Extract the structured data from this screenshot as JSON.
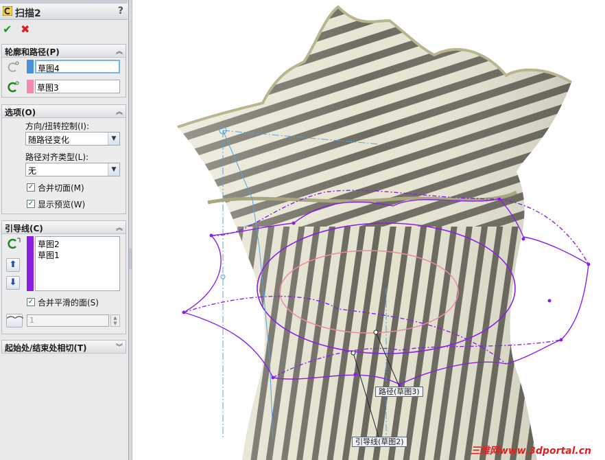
{
  "panel": {
    "title": "扫描2",
    "help": "?",
    "ok_label": "✔",
    "cancel_label": "✖"
  },
  "profile_path": {
    "header": "轮廓和路径(P)",
    "profile_value": "草图4",
    "path_value": "草图3",
    "profile_color": "#4a90d9",
    "path_color": "#f08cb4"
  },
  "options": {
    "header": "选项(O)",
    "orientation_label": "方向/扭转控制(I):",
    "orientation_value": "随路径变化",
    "path_align_label": "路径对齐类型(L):",
    "path_align_value": "无",
    "merge_tangent_label": "合并切面(M)",
    "show_preview_label": "显示预览(W)"
  },
  "guides": {
    "header": "引导线(C)",
    "items": [
      "草图2",
      "草图1"
    ],
    "merge_smooth_label": "合并平滑的面(S)",
    "spinner_value": "1",
    "list_color": "#8a1fe6"
  },
  "tangency": {
    "header": "起始处/结束处相切(T)"
  },
  "viewport": {
    "path_callout": "路径(草图3)",
    "guide_callout": "引导线(草图2)",
    "watermark": "三维网www.3dportal.cn"
  },
  "colors": {
    "accent": "#7ab3e6",
    "guide_curve": "#8a1fe6",
    "path_curve": "#e88aa8",
    "surface_light": "#e9e8d9",
    "surface_dark": "#6c6a5e"
  }
}
